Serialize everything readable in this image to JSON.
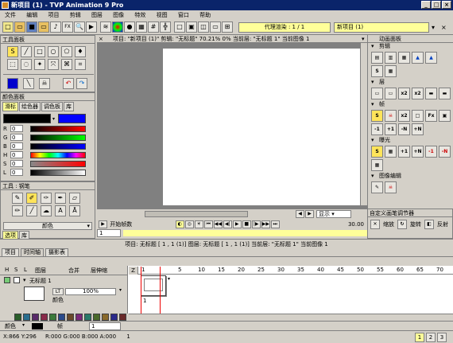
{
  "app": {
    "title": "新项目 (1) - TVP Animation 9 Pro"
  },
  "menu": [
    "文件",
    "编辑",
    "项目",
    "剪辑",
    "图层",
    "图像",
    "特效",
    "视图",
    "窗口",
    "帮助"
  ],
  "toolbar": {
    "proxy_label": "代理渲染 : 1 / 1",
    "project_tab": "新项目 (1)"
  },
  "tool_panel": {
    "title": "工具面板"
  },
  "color_panel": {
    "title": "颜色面板",
    "tabs": [
      "滑标",
      "绘色器",
      "调色板",
      "库"
    ],
    "active_tab": "滑标",
    "sliders": [
      {
        "label": "R",
        "value": "0"
      },
      {
        "label": "G",
        "value": "0"
      },
      {
        "label": "B",
        "value": "0"
      },
      {
        "label": "H",
        "value": "0"
      },
      {
        "label": "S",
        "value": "0"
      },
      {
        "label": "L",
        "value": "0"
      }
    ]
  },
  "brush_panel": {
    "title": "工具 : 钢笔",
    "color_label": "颜色",
    "tabs": [
      "选项",
      "库"
    ]
  },
  "canvas": {
    "info": "项目: \"新项目 (1)\" 剪辑: \"无标题\" 70.21%  0%  当前层: \"无标题 1\" 当前图像 1",
    "start_frame_label": "开始帧数",
    "start_frame": "1",
    "display_label": "显示",
    "fps": "30.00"
  },
  "anim_panel": {
    "title": "动画面板",
    "sections": [
      "剪辑",
      "层",
      "帧",
      "曝光",
      "图像编辑"
    ],
    "labels": {
      "b2": "x2",
      "b3": "x2",
      "copy": "+1",
      "copy2": "+N",
      "del": "-1",
      "del2": "-N"
    }
  },
  "custom_panel": {
    "title": "自定义画笔调节器",
    "items": [
      "缩放",
      "旋转",
      "反射"
    ]
  },
  "status_line": "项目: 无标题 [ 1 , 1 (1)]     图层: 无标题 [ 1 , 1 (1)]     当前层: \"无标题 1\"  当前图像 1",
  "timeline": {
    "tabs": [
      "项目",
      "时间轴",
      "摄影表"
    ],
    "active_tab": "时间轴",
    "header": [
      "H",
      "S",
      "L",
      "图层",
      "合并",
      "层伸缩"
    ],
    "layer_name": "无标题 1",
    "opacity": "100%",
    "color_label": "颜色",
    "frame_label": "1",
    "mode_label": "LT",
    "frame_ticks": [
      "1",
      "5",
      "10",
      "15",
      "20",
      "25",
      "30",
      "35",
      "40",
      "45",
      "50",
      "55",
      "60",
      "65",
      "70"
    ]
  },
  "bottom": {
    "color_label": "颜色",
    "frame_label": "帧",
    "frame_value": "1"
  },
  "statusbar": {
    "coords": "X:866 Y:296",
    "rgba": "R:000 G:000 B:000 A:000",
    "frame": "1",
    "pages": [
      "1",
      "2",
      "3"
    ]
  },
  "colors": {
    "swatches": [
      "#2a5f2a",
      "#2a6f8f",
      "#5a2a6a",
      "#8a2a4a",
      "#3a7a3a",
      "#2a4a8a",
      "#6a4a2a",
      "#7a2a7a",
      "#2a7a6a",
      "#4a6a2a",
      "#8a6a2a",
      "#2a2a8a",
      "#6a2a2a"
    ]
  }
}
